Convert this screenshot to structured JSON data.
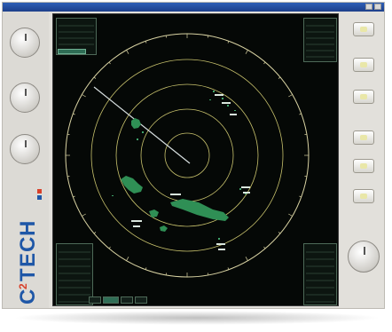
{
  "window": {
    "title": ""
  },
  "brand": {
    "logo_text": "C2TECH",
    "logo_letters": [
      "C",
      "2",
      "T",
      "E",
      "C",
      "H"
    ],
    "tagline": "",
    "colors": {
      "blue": "#1f57a7",
      "red": "#d8402a",
      "gray": "#bfbfbf"
    }
  },
  "left_knobs": [
    {
      "id": "gain",
      "label": ""
    },
    {
      "id": "sea",
      "label": ""
    },
    {
      "id": "rain",
      "label": ""
    }
  ],
  "radar": {
    "range_rings": 4,
    "bearing_line_deg": 300,
    "colors": {
      "ring": "#c9c36d",
      "outer": "#d8d2a2",
      "land": "#2f8f55",
      "target": "#d9e6dd",
      "line": "#d7dfe0"
    }
  },
  "panels": {
    "top_left": [
      "",
      "",
      "",
      ""
    ],
    "top_right": [
      "",
      "",
      "",
      "",
      "",
      ""
    ],
    "bottom_left": [
      "",
      "",
      "",
      "",
      "",
      "",
      "",
      ""
    ],
    "bottom_right": [
      "",
      "",
      "",
      "",
      "",
      "",
      "",
      ""
    ]
  },
  "right_buttons": [
    {
      "id": "btn-1"
    },
    {
      "id": "btn-2"
    },
    {
      "id": "btn-3"
    },
    {
      "id": "btn-4"
    },
    {
      "id": "btn-5"
    },
    {
      "id": "btn-6"
    }
  ],
  "right_label": ""
}
